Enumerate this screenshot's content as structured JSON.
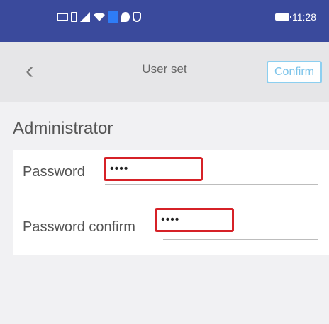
{
  "status_bar": {
    "time": "11:28",
    "icons": [
      "message-icon",
      "sim-icon",
      "signal-icon",
      "wifi-icon",
      "app-icon",
      "location-icon",
      "shield-icon",
      "battery-icon"
    ]
  },
  "header": {
    "title": "User set",
    "confirm_label": "Confirm",
    "back_glyph": "‹"
  },
  "section": {
    "title": "Administrator"
  },
  "fields": [
    {
      "label": "Password",
      "value": "••••"
    },
    {
      "label": "Password confirm",
      "value": "••••"
    }
  ],
  "colors": {
    "status_bar": "#3a4a9c",
    "highlight": "#d62127",
    "confirm_border": "#8ccff0"
  }
}
